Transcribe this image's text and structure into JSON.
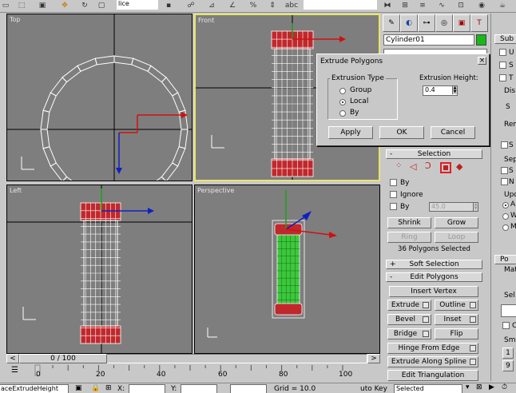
{
  "colors": {
    "viewport_bg": "#7e7e7e",
    "active_border": "#e8e66a",
    "selection_red": "#c0282c",
    "extruded_green": "#3cc83c",
    "axis_red": "#d01010",
    "axis_blue": "#1020c0",
    "axis_green": "#18a018",
    "accent_green": "#18b818"
  },
  "toolbar": {
    "selection_filter": "lice",
    "view_dropdown": "iew",
    "icons": [
      "select-region-icon",
      "window-crossing-icon",
      "move-icon",
      "rotate-icon",
      "scale-icon",
      "snap-icon",
      "angle-snap-icon",
      "percent-snap-icon",
      "mirror-icon",
      "align-icon",
      "curve-editor-icon",
      "material-editor-icon"
    ]
  },
  "viewports": {
    "top": {
      "label": "Top"
    },
    "front": {
      "label": "Front"
    },
    "left": {
      "label": "Left"
    },
    "perspective": {
      "label": "Perspective"
    }
  },
  "command_panel": {
    "tabs": [
      "create-tab-icon",
      "modify-tab-icon",
      "hierarchy-tab-icon",
      "motion-tab-icon",
      "display-tab-icon",
      "utilities-tab-icon"
    ],
    "object_name": "Cylinder01",
    "object_color": "#18b818",
    "modifier_stack_value": "",
    "selection": {
      "title": "Selection",
      "by_vertex_label": "By",
      "ignore_backfacing_label": "Ignore",
      "by_angle_label": "By",
      "angle_value": "45.0",
      "shrink_label": "Shrink",
      "grow_label": "Grow",
      "ring_label": "Ring",
      "loop_label": "Loop",
      "status": "36 Polygons Selected"
    },
    "soft_selection": {
      "sign": "+",
      "title": "Soft Selection"
    },
    "edit_polygons": {
      "sign": "-",
      "title": "Edit Polygons",
      "insert_vertex": "Insert Vertex",
      "extrude": "Extrude",
      "outline": "Outline",
      "bevel": "Bevel",
      "inset": "Inset",
      "bridge": "Bridge",
      "flip": "Flip",
      "hinge_from_edge": "Hinge From Edge",
      "extrude_along_spline": "Extrude Along Spline",
      "edit_triangulation": "Edit Triangulation"
    }
  },
  "far_right": {
    "sub_title": "Sub",
    "letters": [
      "U",
      "S",
      "T",
      "Dis",
      "S",
      "Rem",
      "S",
      "Sep",
      "S",
      "N",
      "Upd",
      "A",
      "W",
      "M"
    ],
    "po_title": "Po",
    "mat": "Mat",
    "sel": "Sel",
    "c": "C",
    "smo": "Smo",
    "smo_rows": [
      "1",
      "9"
    ]
  },
  "dialog": {
    "title": "Extrude Polygons",
    "close": "×",
    "extrusion_type_label": "Extrusion Type",
    "options": [
      {
        "label": "Group",
        "selected": false
      },
      {
        "label": "Local",
        "selected": true
      },
      {
        "label": "By",
        "selected": false
      }
    ],
    "height_label": "Extrusion Height:",
    "height_value": "0.4",
    "apply": "Apply",
    "ok": "OK",
    "cancel": "Cancel"
  },
  "timeslider": {
    "frame": "0 / 100"
  },
  "trackbar": {
    "ticks": [
      "0",
      "20",
      "40",
      "60",
      "80",
      "100"
    ]
  },
  "statusbar": {
    "prompt": "aceExtrudeHeight",
    "x_label": "X:",
    "y_label": "Y:",
    "grid_label": "Grid = 10.0",
    "autokey_label": "uto Key",
    "autokey_value": "Selected"
  }
}
